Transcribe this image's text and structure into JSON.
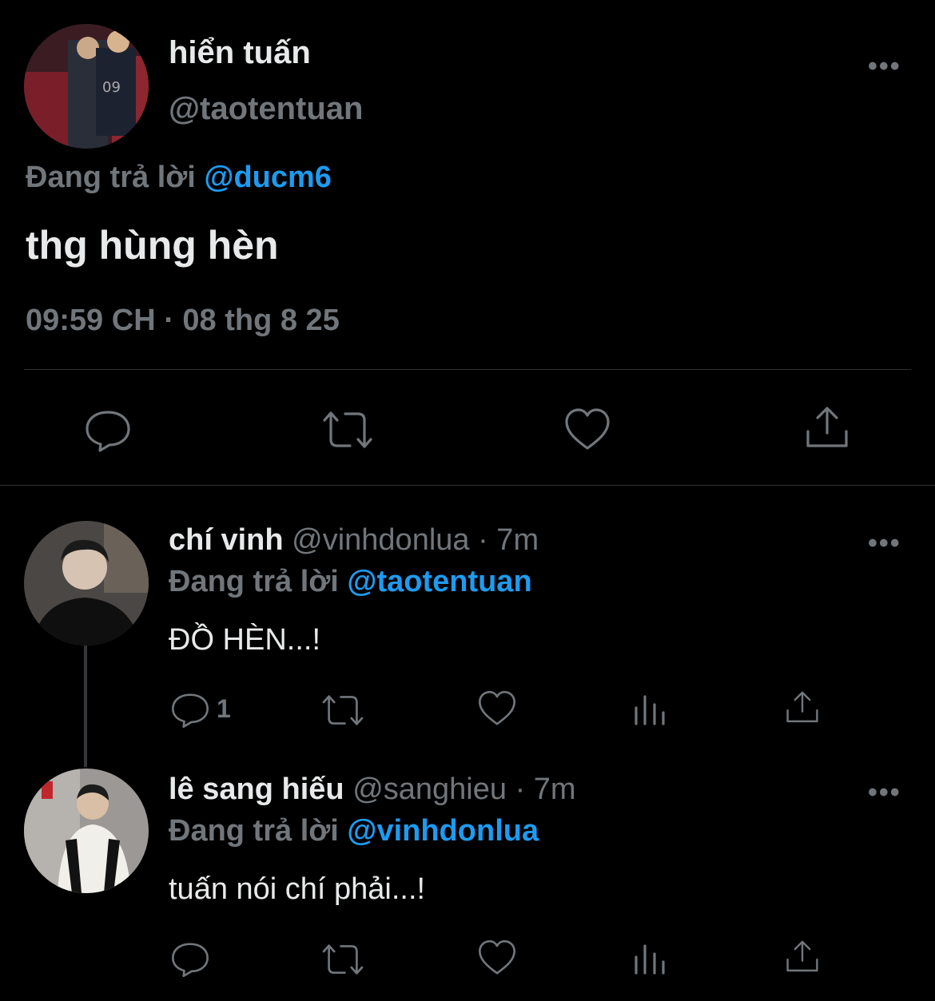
{
  "main_tweet": {
    "display_name": "hiển tuấn",
    "handle": "@taotentuan",
    "reply_prefix": "Đang trả lời",
    "reply_to": "@ducm6",
    "text": "thg hùng hèn",
    "timestamp": "09:59 CH · 08 thg 8 25"
  },
  "replies": [
    {
      "display_name": "chí vinh",
      "meta": "@vinhdonlua · 7m",
      "reply_prefix": "Đang trả lời",
      "reply_to": "@taotentuan",
      "text": "ĐỒ HÈN...!",
      "reply_count": "1"
    },
    {
      "display_name": "lê sang hiếu",
      "meta": "@sanghieu · 7m",
      "reply_prefix": "Đang trả lời",
      "reply_to": "@vinhdonlua",
      "text": "tuấn nói chí phải...!",
      "reply_count": ""
    }
  ],
  "more_label": "•••",
  "icons": [
    "reply-icon",
    "retweet-icon",
    "like-icon",
    "share-icon",
    "views-icon",
    "more-icon"
  ],
  "colors": {
    "background": "#000000",
    "text": "#e7e9ea",
    "muted": "#71767b",
    "link": "#1d9bf0",
    "divider": "#2f3336"
  }
}
